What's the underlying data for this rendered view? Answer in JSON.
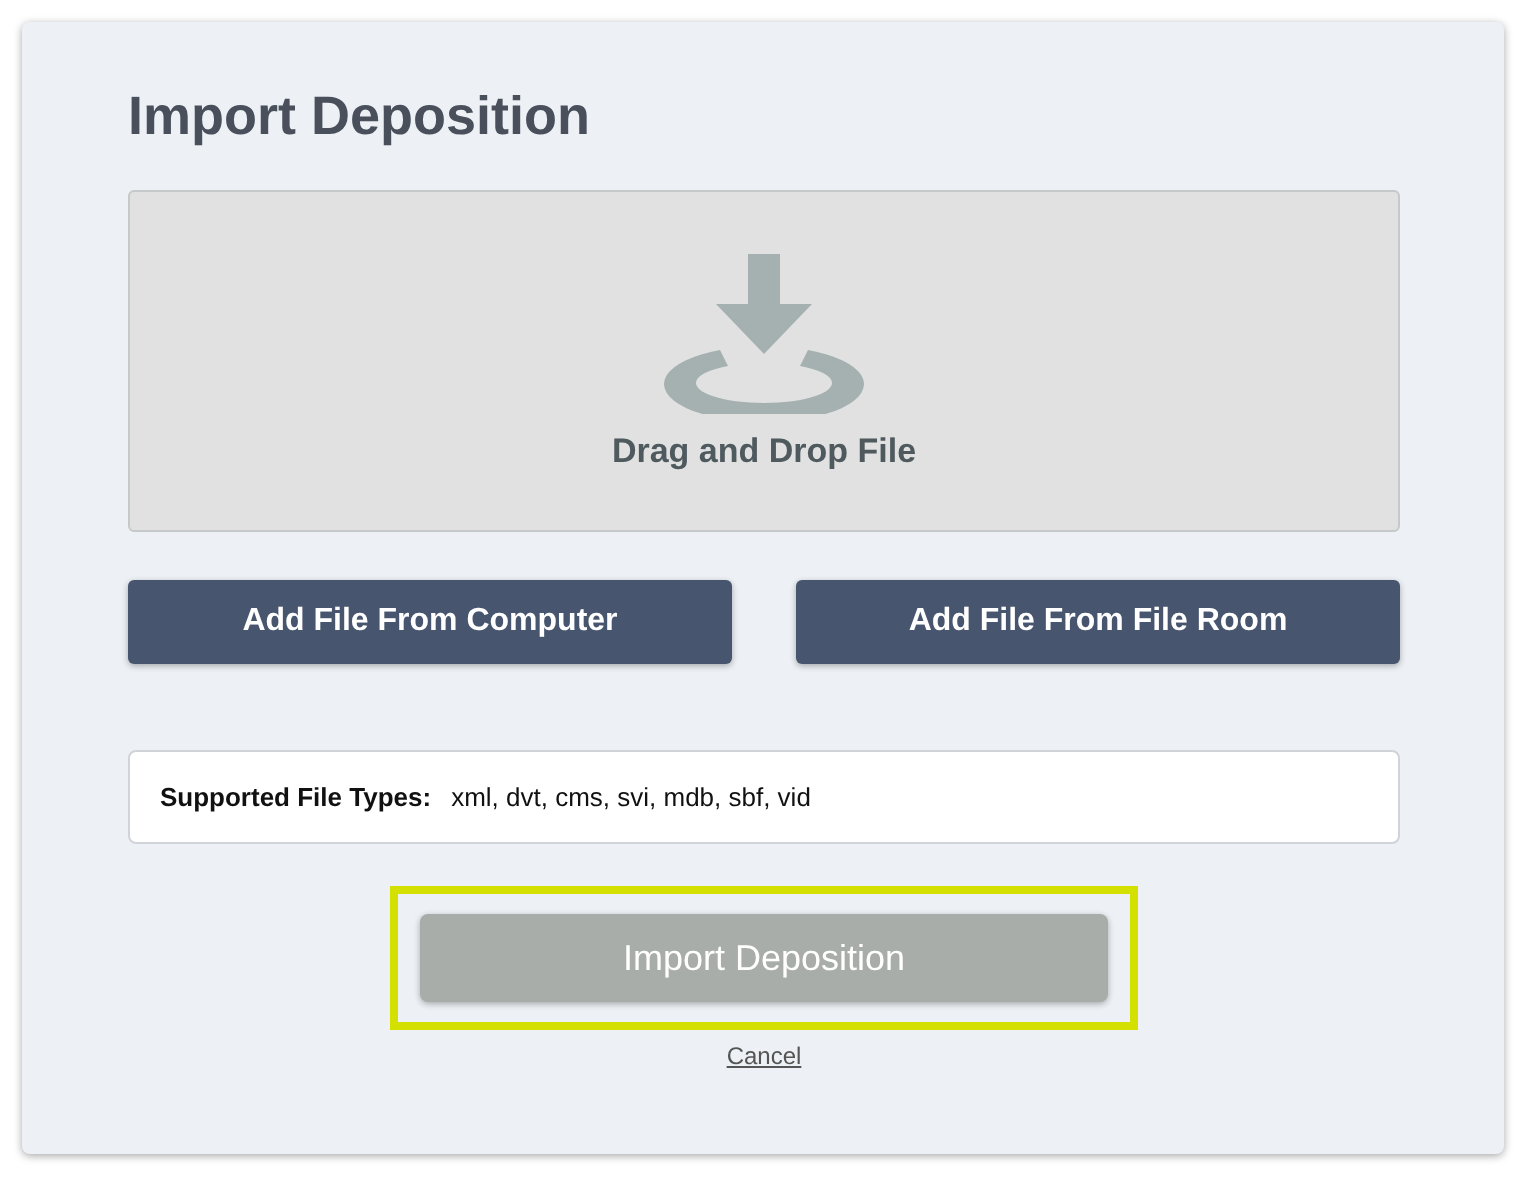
{
  "title": "Import Deposition",
  "drop_zone": {
    "label": "Drag and Drop File"
  },
  "buttons": [
    {
      "label": "Add File From Computer"
    },
    {
      "label": "Add File From File Room"
    }
  ],
  "supported_types": {
    "label": "Supported File Types:",
    "value": "xml, dvt, cms, svi, mdb, sbf, vid"
  },
  "import_button": {
    "label": "Import Deposition",
    "disabled": true,
    "highlighted": true
  },
  "cancel_link": "Cancel"
}
